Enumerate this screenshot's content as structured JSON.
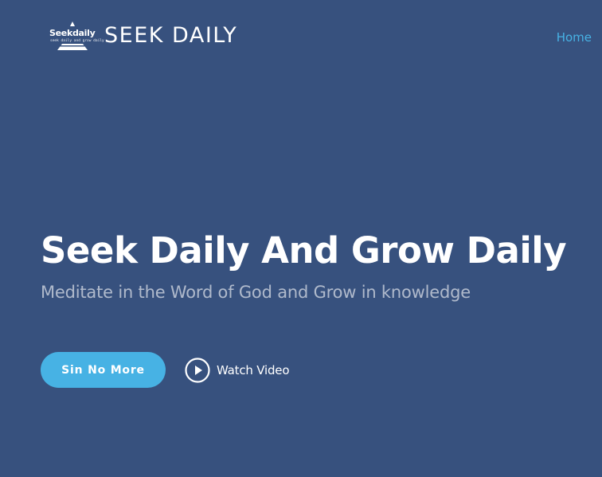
{
  "header": {
    "logo": {
      "wordmark": "Seekdaily",
      "tagline": "seek daily and grow daily"
    },
    "brand_name": "SEEK DAILY",
    "nav": {
      "home_label": "Home"
    }
  },
  "hero": {
    "title": "Seek Daily And Grow Daily",
    "subtitle": "Meditate in the Word of God and Grow in knowledge",
    "cta_label": "Sin No More",
    "video_label": "Watch Video",
    "video_icon": "play-circle-icon"
  },
  "colors": {
    "background": "#37517e",
    "accent": "#47b2e4",
    "text": "#ffffff"
  }
}
